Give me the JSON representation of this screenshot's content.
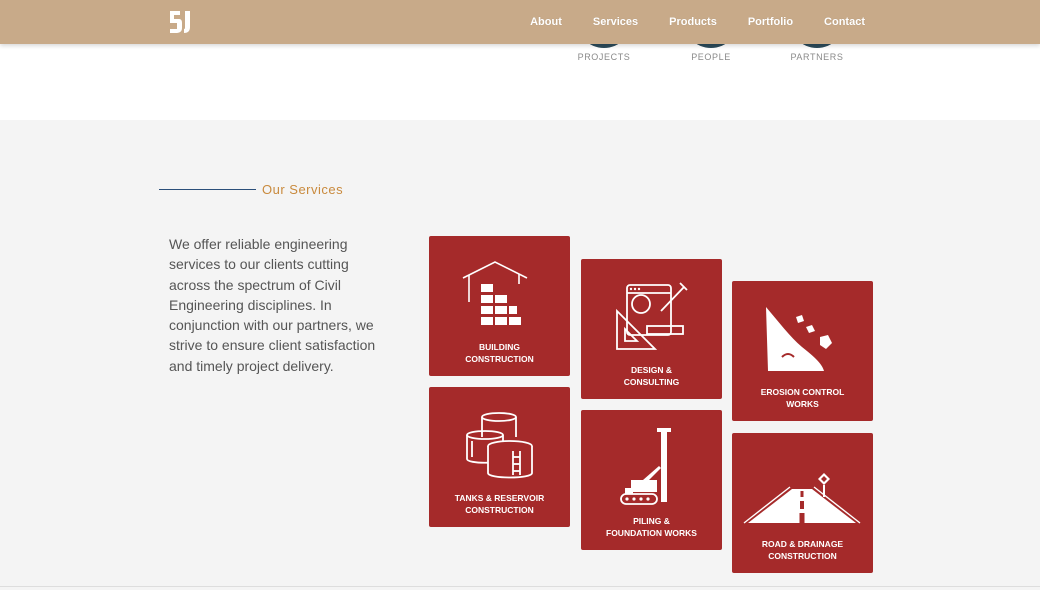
{
  "nav": {
    "items": [
      "About",
      "Services",
      "Products",
      "Portfolio",
      "Contact"
    ]
  },
  "stats": {
    "projects": "PROJECTS",
    "people": "PEOPLE",
    "partners": "PARTNERS"
  },
  "services": {
    "heading": "Our Services",
    "intro": "We offer reliable engineering services to our clients cutting across the spectrum of Civil Engineering disciplines. In conjunction with our partners, we strive to ensure client satisfaction and timely project delivery.",
    "tiles": [
      {
        "line1": "BUILDING",
        "line2": "CONSTRUCTION",
        "icon": "brick-house-icon"
      },
      {
        "line1": "TANKS & RESERVOIR",
        "line2": "CONSTRUCTION",
        "icon": "tanks-icon"
      },
      {
        "line1": "DESIGN &",
        "line2": "CONSULTING",
        "icon": "drafting-tools-icon"
      },
      {
        "line1": "PILING &",
        "line2": "FOUNDATION WORKS",
        "icon": "pile-driver-icon"
      },
      {
        "line1": "EROSION CONTROL",
        "line2": "WORKS",
        "icon": "landslide-icon"
      },
      {
        "line1": "ROAD & DRAINAGE",
        "line2": "CONSTRUCTION",
        "icon": "road-icon"
      }
    ]
  },
  "colors": {
    "navbar": "#c8aa89",
    "tile": "#a52a2a",
    "accent": "#c98a3d",
    "rule": "#2b4f7a"
  }
}
